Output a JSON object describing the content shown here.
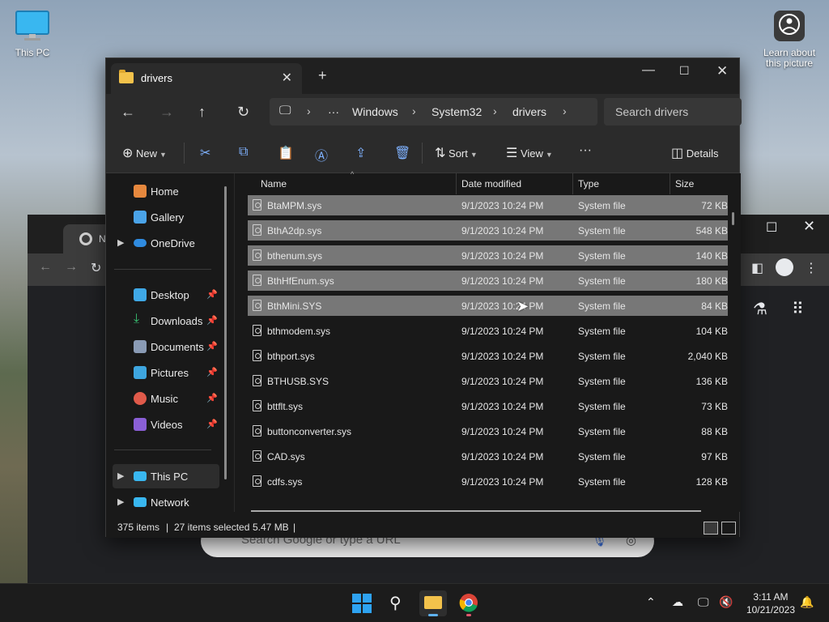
{
  "desktop": {
    "this_pc_label": "This PC",
    "learn_label_1": "Learn about",
    "learn_label_2": "this picture"
  },
  "chrome": {
    "tab_title": "New Tab",
    "omnibox_placeholder": "Search Google or type a URL"
  },
  "explorer": {
    "tab_title": "drivers",
    "breadcrumbs": [
      "Windows",
      "System32",
      "drivers"
    ],
    "search_placeholder": "Search drivers",
    "commands": {
      "new": "New",
      "sort": "Sort",
      "view": "View",
      "details": "Details"
    },
    "nav": {
      "home": "Home",
      "gallery": "Gallery",
      "onedrive": "OneDrive",
      "desktop": "Desktop",
      "downloads": "Downloads",
      "documents": "Documents",
      "pictures": "Pictures",
      "music": "Music",
      "videos": "Videos",
      "this_pc": "This PC",
      "network": "Network"
    },
    "columns": {
      "name": "Name",
      "date": "Date modified",
      "type": "Type",
      "size": "Size"
    },
    "files": [
      {
        "name": "BtaMPM.sys",
        "date": "9/1/2023 10:24 PM",
        "type": "System file",
        "size": "72 KB",
        "selected": true
      },
      {
        "name": "BthA2dp.sys",
        "date": "9/1/2023 10:24 PM",
        "type": "System file",
        "size": "548 KB",
        "selected": true
      },
      {
        "name": "bthenum.sys",
        "date": "9/1/2023 10:24 PM",
        "type": "System file",
        "size": "140 KB",
        "selected": true
      },
      {
        "name": "BthHfEnum.sys",
        "date": "9/1/2023 10:24 PM",
        "type": "System file",
        "size": "180 KB",
        "selected": true
      },
      {
        "name": "BthMini.SYS",
        "date": "9/1/2023 10:24 PM",
        "type": "System file",
        "size": "84 KB",
        "selected": true
      },
      {
        "name": "bthmodem.sys",
        "date": "9/1/2023 10:24 PM",
        "type": "System file",
        "size": "104 KB",
        "selected": false
      },
      {
        "name": "bthport.sys",
        "date": "9/1/2023 10:24 PM",
        "type": "System file",
        "size": "2,040 KB",
        "selected": false
      },
      {
        "name": "BTHUSB.SYS",
        "date": "9/1/2023 10:24 PM",
        "type": "System file",
        "size": "136 KB",
        "selected": false
      },
      {
        "name": "bttflt.sys",
        "date": "9/1/2023 10:24 PM",
        "type": "System file",
        "size": "73 KB",
        "selected": false
      },
      {
        "name": "buttonconverter.sys",
        "date": "9/1/2023 10:24 PM",
        "type": "System file",
        "size": "88 KB",
        "selected": false
      },
      {
        "name": "CAD.sys",
        "date": "9/1/2023 10:24 PM",
        "type": "System file",
        "size": "97 KB",
        "selected": false
      },
      {
        "name": "cdfs.sys",
        "date": "9/1/2023 10:24 PM",
        "type": "System file",
        "size": "128 KB",
        "selected": false
      }
    ],
    "status": {
      "item_count": "375 items",
      "selection": "27 items selected",
      "selection_size": "5.47 MB"
    }
  },
  "taskbar": {
    "time": "3:11 AM",
    "date": "10/21/2023"
  }
}
